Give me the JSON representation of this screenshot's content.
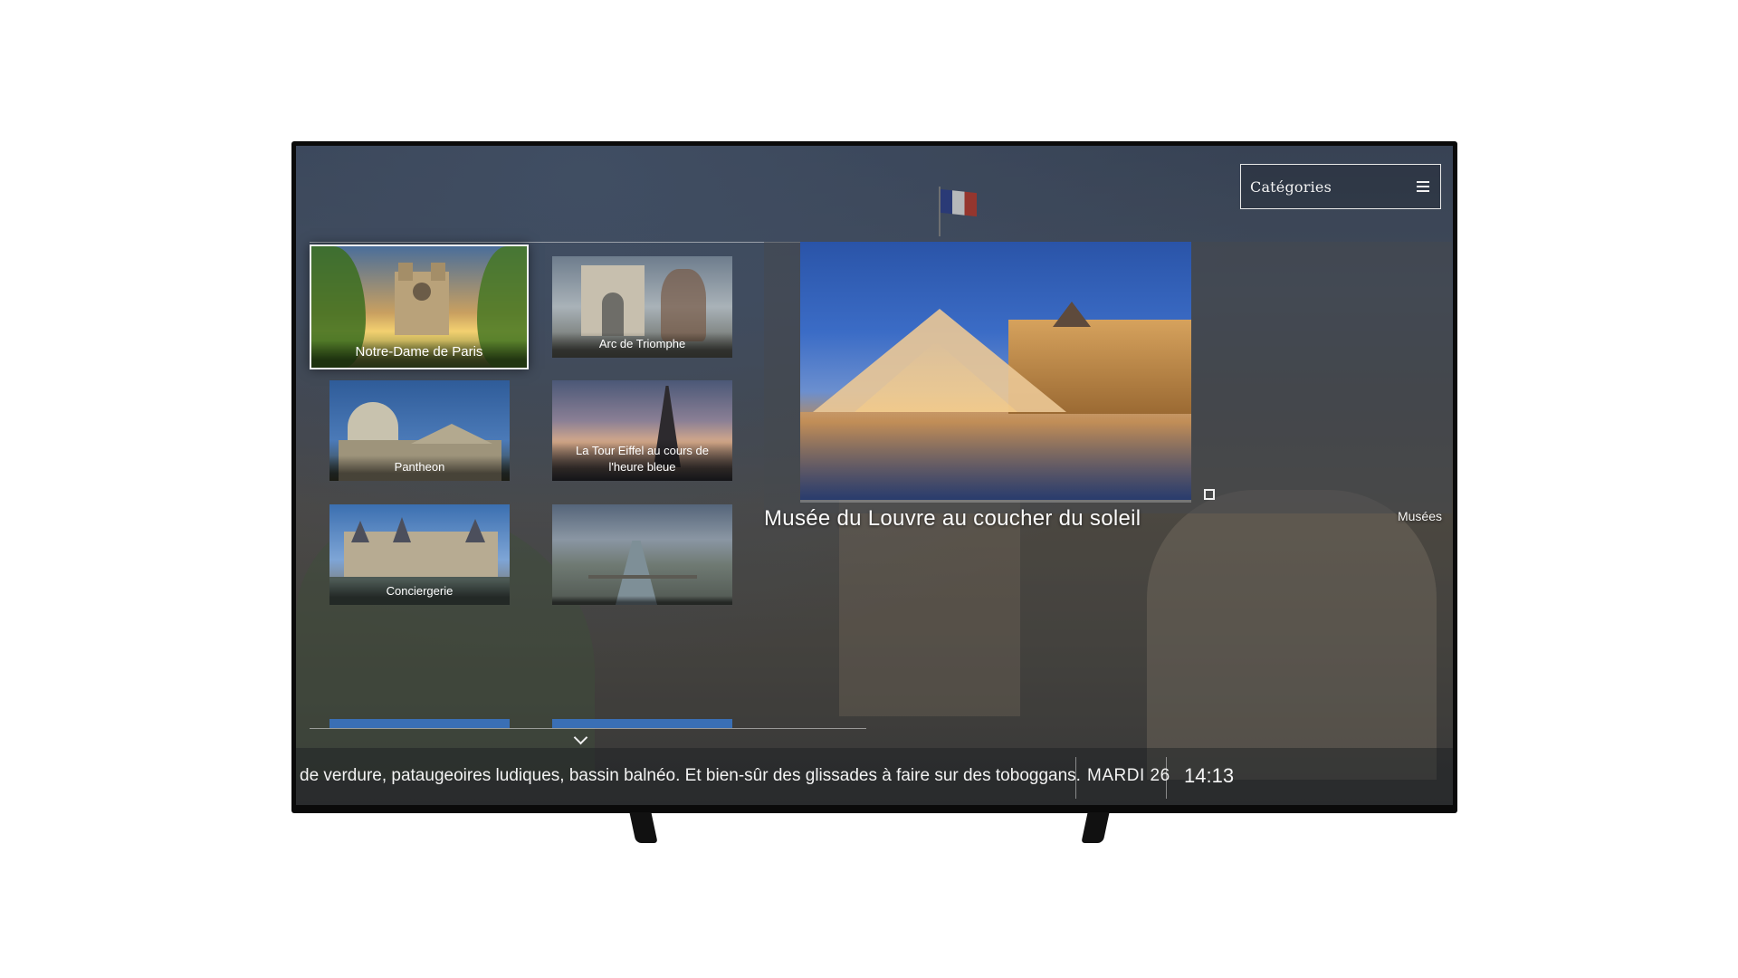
{
  "header": {
    "categories_label": "Catégories",
    "menu_icon": "hamburger-icon"
  },
  "tiles": [
    {
      "label": "Notre-Dame de Paris",
      "focused": true
    },
    {
      "label": "Arc de Triomphe"
    },
    {
      "label": "Pantheon"
    },
    {
      "label": "La Tour Eiffel au cours de l'heure bleue"
    },
    {
      "label": "Conciergerie"
    },
    {
      "label": ""
    }
  ],
  "scroll_icon": "chevron-down-icon",
  "featured": {
    "title": "Musée du Louvre au coucher du soleil",
    "category": "Musées",
    "fullscreen_icon": "fullscreen-icon"
  },
  "ticker": {
    "text": "de verdure, pataugeoires ludiques, bassin balnéo. Et bien-sûr des glissades à faire sur des toboggans.",
    "date": "MARDI 26",
    "time": "14:13"
  }
}
